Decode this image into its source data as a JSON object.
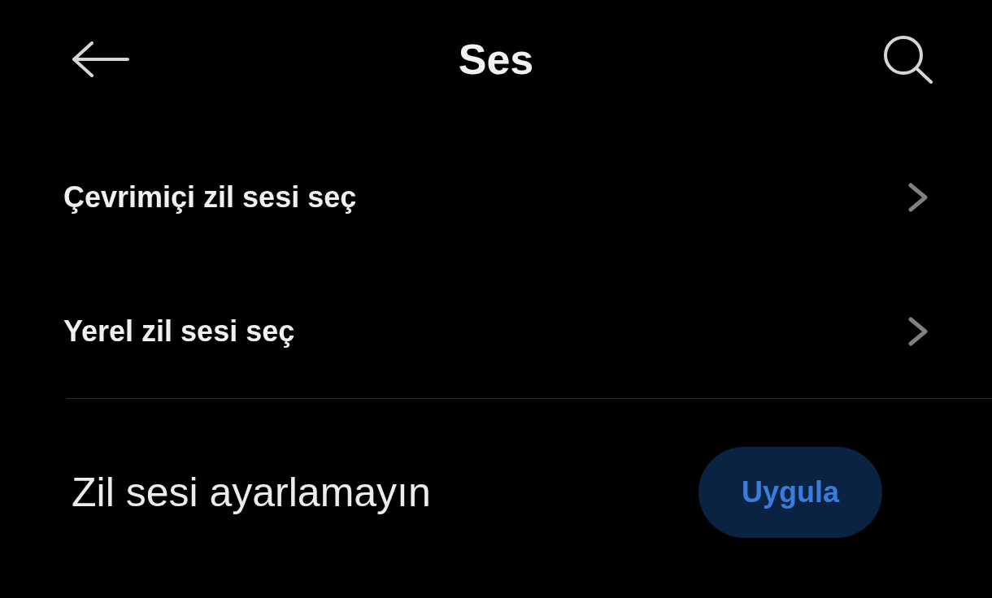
{
  "header": {
    "title": "Ses"
  },
  "items": [
    {
      "label": "Çevrimiçi zil sesi seç"
    },
    {
      "label": "Yerel zil sesi seç"
    }
  ],
  "option": {
    "label": "Zil sesi ayarlamayın",
    "button": "Uygula"
  }
}
